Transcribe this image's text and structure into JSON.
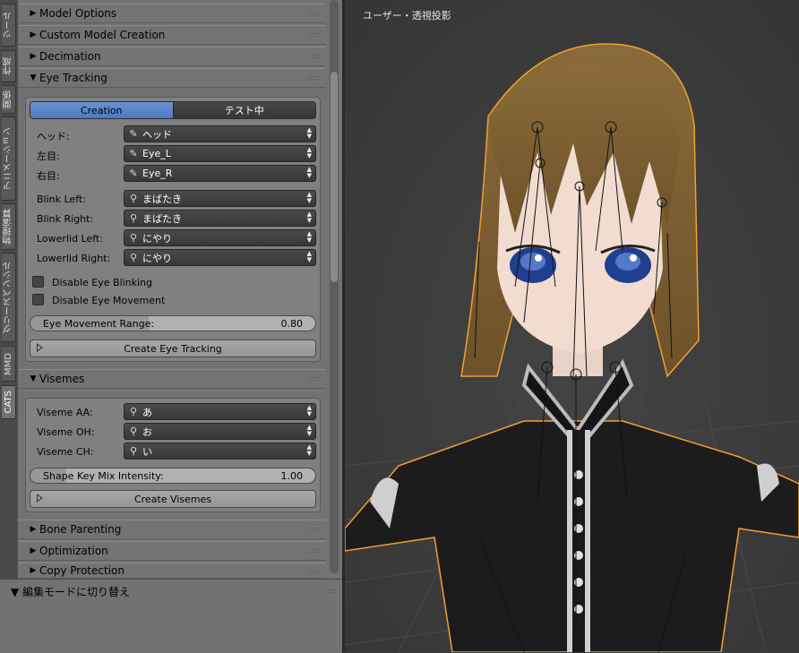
{
  "tabs": [
    "ツール",
    "作成",
    "関係",
    "アニメーション",
    "物理演算",
    "グリースペンシル",
    "MMD",
    "CATS"
  ],
  "active_tab": "CATS",
  "panels": {
    "model_options": "Model Options",
    "custom_model": "Custom Model Creation",
    "decimation": "Decimation",
    "eye_tracking": "Eye Tracking",
    "visemes": "Visemes",
    "bone_parenting": "Bone Parenting",
    "optimization": "Optimization",
    "copy_protection": "Copy Protection"
  },
  "eye_tracking": {
    "mode_creation": "Creation",
    "mode_testing": "テスト中",
    "head_label": "ヘッド:",
    "head_value": "ヘッド",
    "left_eye_label": "左目:",
    "left_eye_value": "Eye_L",
    "right_eye_label": "右目:",
    "right_eye_value": "Eye_R",
    "blink_left_label": "Blink Left:",
    "blink_left_value": "まばたき",
    "blink_right_label": "Blink Right:",
    "blink_right_value": "まばたき",
    "lowerlid_left_label": "Lowerlid Left:",
    "lowerlid_left_value": "にやり",
    "lowerlid_right_label": "Lowerlid Right:",
    "lowerlid_right_value": "にやり",
    "disable_blinking": "Disable Eye Blinking",
    "disable_movement": "Disable Eye Movement",
    "movement_range_label": "Eye Movement Range:",
    "movement_range_value": "0.80",
    "movement_range_fraction": 0.8,
    "create_button": "Create Eye Tracking"
  },
  "visemes": {
    "aa_label": "Viseme AA:",
    "aa_value": "あ",
    "oh_label": "Viseme OH:",
    "oh_value": "お",
    "ch_label": "Viseme CH:",
    "ch_value": "い",
    "mix_label": "Shape Key Mix Intensity:",
    "mix_value": "1.00",
    "create_button": "Create Visemes"
  },
  "operator_panel_title": "編集モードに切り替え",
  "viewport_title": "ユーザー・透視投影",
  "colors": {
    "accent": "#5b87cc",
    "panel_bg": "#727272",
    "viewport_bg": "#3a3a3a",
    "selection_outline": "#f0a030"
  }
}
